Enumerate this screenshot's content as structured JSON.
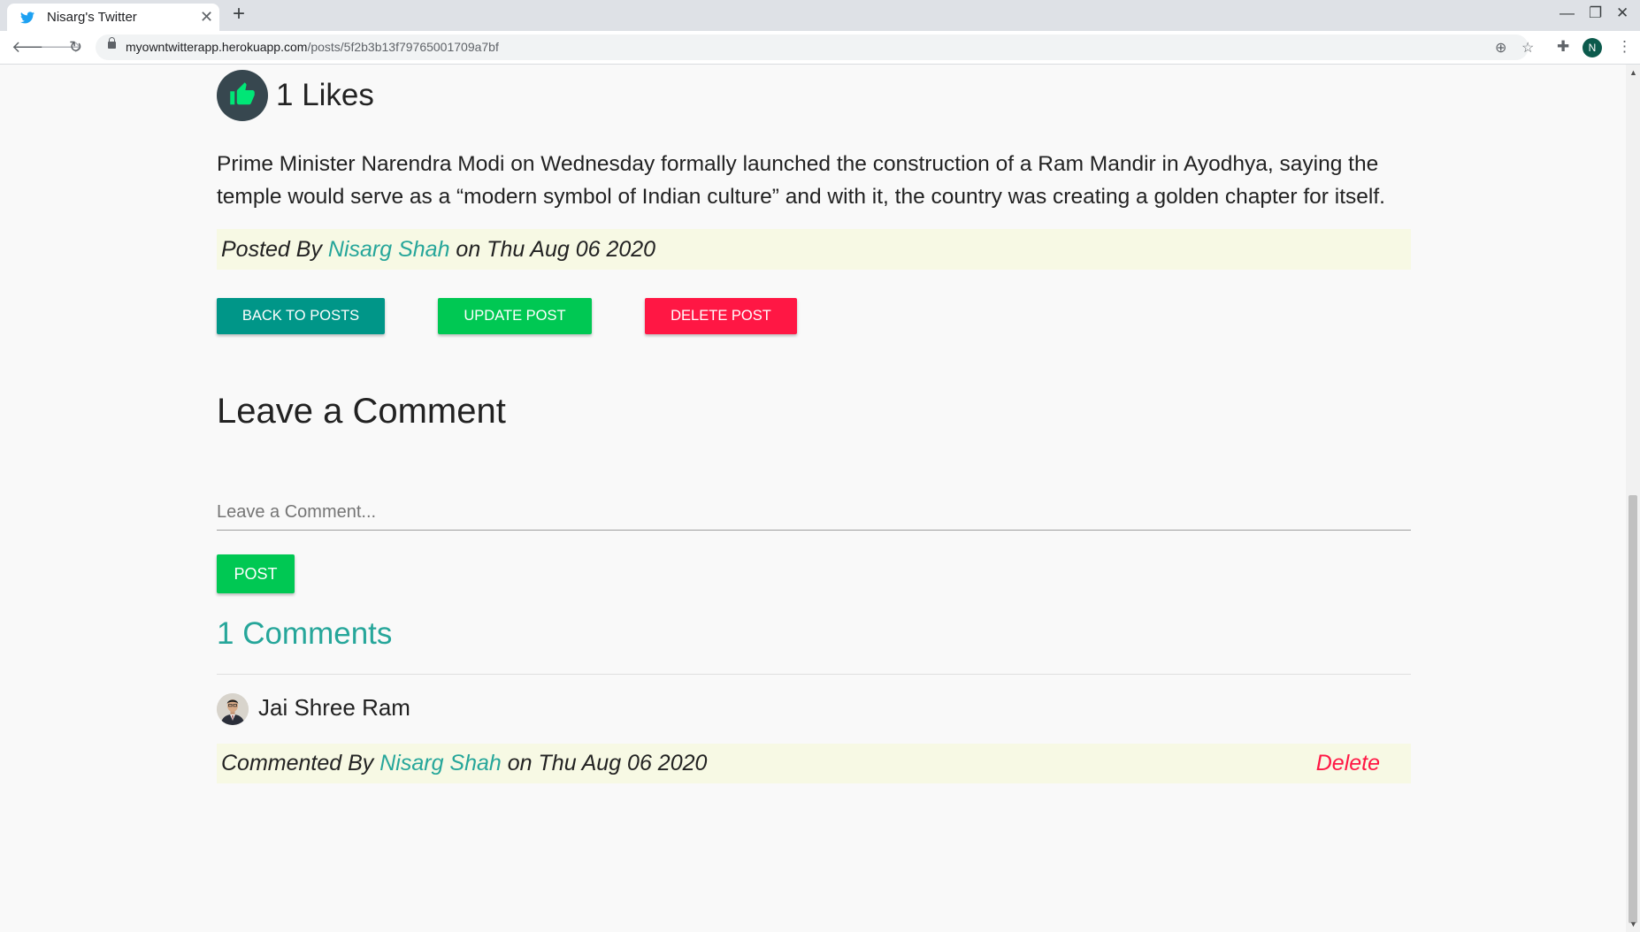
{
  "browser": {
    "tab_title": "Nisarg's Twitter",
    "url_host": "myowntwitterapp.herokuapp.com",
    "url_path": "/posts/5f2b3b13f79765001709a7bf",
    "profile_initial": "N"
  },
  "post": {
    "likes_label": "1 Likes",
    "body": "Prime Minister Narendra Modi on Wednesday formally launched the construction of a Ram Mandir in Ayodhya, saying the temple would serve as a “modern symbol of Indian culture” and with it, the country was creating a golden chapter for itself.",
    "posted_by_prefix": "Posted By ",
    "author": "Nisarg Shah",
    "posted_on": " on Thu Aug 06 2020"
  },
  "actions": {
    "back_label": "BACK TO POSTS",
    "update_label": "UPDATE POST",
    "delete_label": "DELETE POST"
  },
  "comment_form": {
    "heading": "Leave a Comment",
    "placeholder": "Leave a Comment...",
    "submit_label": "POST"
  },
  "comments": {
    "heading": "1 Comments",
    "items": [
      {
        "text": "Jai Shree Ram",
        "by_prefix": "Commented By ",
        "author": "Nisarg Shah",
        "on": " on Thu Aug 06 2020",
        "delete_label": "Delete"
      }
    ]
  },
  "colors": {
    "teal": "#26a69a",
    "green": "#00c853",
    "red": "#ff1744",
    "meta_bg": "#f7f9e4"
  }
}
